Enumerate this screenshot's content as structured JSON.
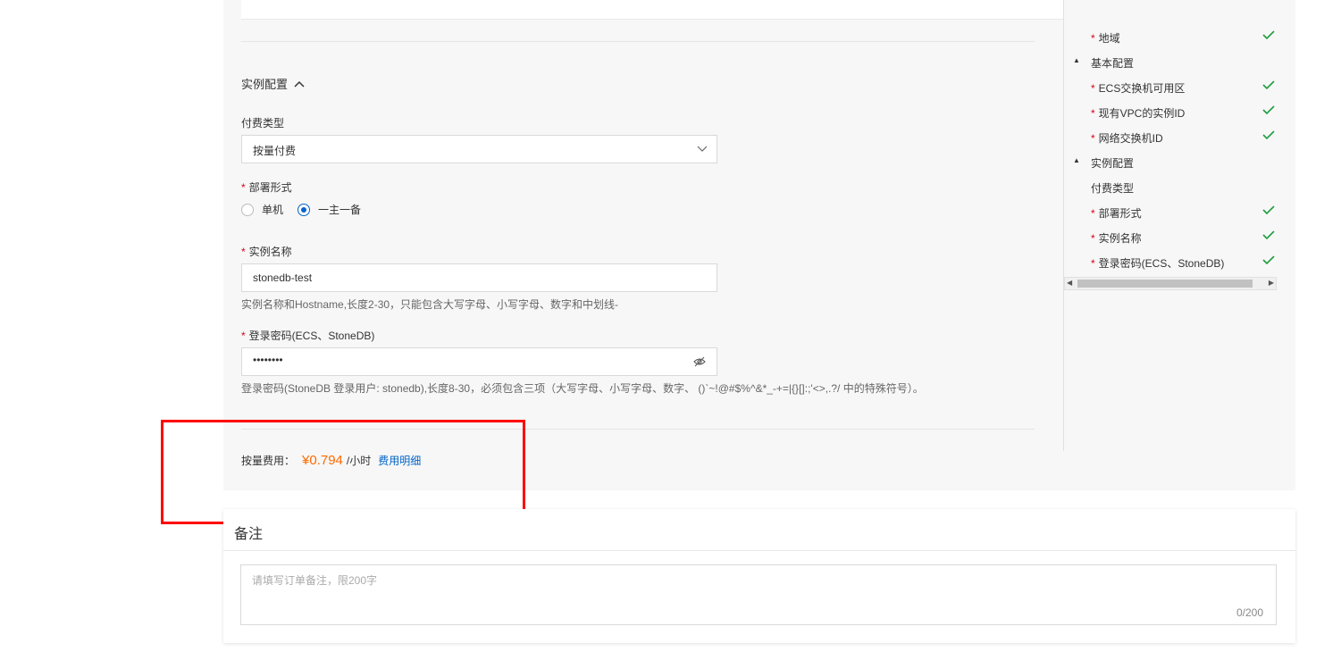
{
  "top_icons": "⧉ ⧉",
  "section": {
    "title": "实例配置"
  },
  "billing": {
    "label": "付费类型",
    "value": "按量付费"
  },
  "deploy": {
    "label": "部署形式",
    "options": [
      "单机",
      "一主一备"
    ],
    "selected": "一主一备"
  },
  "instance_name": {
    "label": "实例名称",
    "value": "stonedb-test",
    "hint": "实例名称和Hostname,长度2-30，只能包含大写字母、小写字母、数字和中划线-"
  },
  "password": {
    "label": "登录密码(ECS、StoneDB)",
    "value": "••••••••",
    "hint": "登录密码(StoneDB 登录用户: stonedb),长度8-30，必须包含三项（大写字母、小写字母、数字、 ()`~!@#$%^&*_-+=|{}[]:;'<>,.?/ 中的特殊符号）。"
  },
  "cost": {
    "label": "按量费用：",
    "price": "¥0.794",
    "unit": "/小时",
    "detail_link": "费用明细"
  },
  "nav": {
    "items": [
      {
        "label": "地域",
        "type": "required",
        "checked": true
      },
      {
        "label": "基本配置",
        "type": "group"
      },
      {
        "label": "ECS交换机可用区",
        "type": "required",
        "checked": true
      },
      {
        "label": "现有VPC的实例ID",
        "type": "required",
        "checked": true
      },
      {
        "label": "网络交换机ID",
        "type": "required",
        "checked": true
      },
      {
        "label": "实例配置",
        "type": "group"
      },
      {
        "label": "付费类型",
        "type": "plain",
        "checked": false
      },
      {
        "label": "部署形式",
        "type": "required",
        "checked": true
      },
      {
        "label": "实例名称",
        "type": "required",
        "checked": true
      },
      {
        "label": "登录密码(ECS、StoneDB)",
        "type": "required",
        "checked": true
      }
    ]
  },
  "notes": {
    "title": "备注",
    "placeholder": "请填写订单备注，限200字",
    "counter": "0/200"
  },
  "colors": {
    "accent": "#0064c8",
    "price": "#ff6a00",
    "required": "#d9001b",
    "check": "#1e9e3e",
    "highlight": "#ff0000"
  }
}
